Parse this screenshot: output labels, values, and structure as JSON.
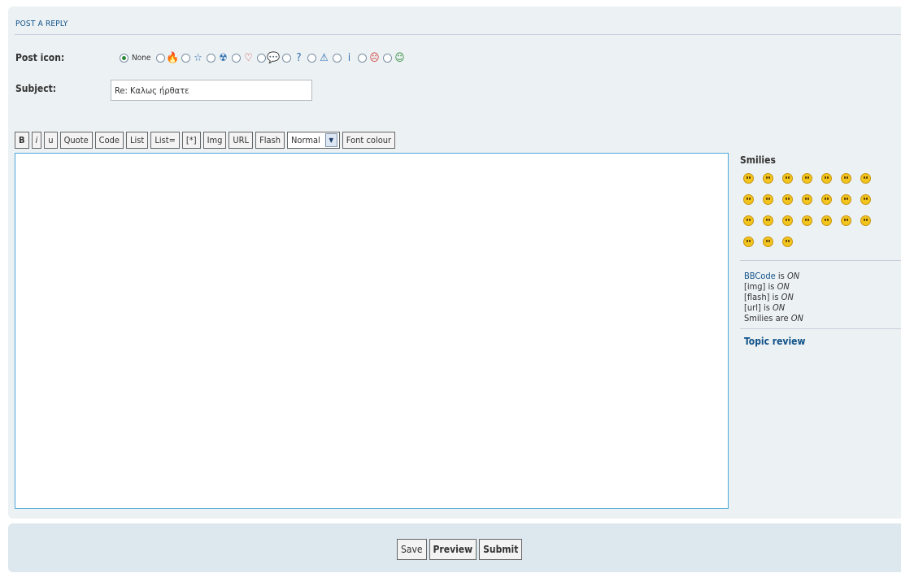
{
  "panel": {
    "title": "POST A REPLY"
  },
  "post_icon": {
    "label": "Post icon:",
    "none_label": "None",
    "options": [
      {
        "name": "flame-icon",
        "glyph": "🔥",
        "color": "#e05a1a"
      },
      {
        "name": "star-icon",
        "glyph": "☆",
        "color": "#2e6db0"
      },
      {
        "name": "radioactive-icon",
        "glyph": "☢",
        "color": "#2e6db0"
      },
      {
        "name": "heart-icon",
        "glyph": "♡",
        "color": "#d33a3a"
      },
      {
        "name": "speech-bubble-icon",
        "glyph": "💬",
        "color": "#2e6db0"
      },
      {
        "name": "question-icon",
        "glyph": "?",
        "color": "#2e6db0"
      },
      {
        "name": "warning-icon",
        "glyph": "⚠",
        "color": "#2e6db0"
      },
      {
        "name": "info-icon",
        "glyph": "i",
        "color": "#2e6db0"
      },
      {
        "name": "sad-face-icon",
        "glyph": "☹",
        "color": "#d33a3a"
      },
      {
        "name": "grin-face-icon",
        "glyph": "☺",
        "color": "#2c8a3c"
      }
    ]
  },
  "subject": {
    "label": "Subject:",
    "value": "Re: Καλως ήρθατε"
  },
  "toolbar": {
    "buttons": [
      {
        "name": "bold-button",
        "label": "B",
        "style": "b"
      },
      {
        "name": "italic-button",
        "label": "i",
        "style": "i"
      },
      {
        "name": "underline-button",
        "label": "u",
        "style": "u"
      },
      {
        "name": "quote-button",
        "label": "Quote",
        "style": ""
      },
      {
        "name": "code-button",
        "label": "Code",
        "style": ""
      },
      {
        "name": "list-button",
        "label": "List",
        "style": ""
      },
      {
        "name": "ordered-list-button",
        "label": "List=",
        "style": ""
      },
      {
        "name": "list-item-button",
        "label": "[*]",
        "style": ""
      },
      {
        "name": "img-button",
        "label": "Img",
        "style": ""
      },
      {
        "name": "url-button",
        "label": "URL",
        "style": ""
      },
      {
        "name": "flash-button",
        "label": "Flash",
        "style": ""
      }
    ],
    "font_size_value": "Normal",
    "font_colour_label": "Font colour"
  },
  "sidebar": {
    "smilies_heading": "Smilies",
    "smilies_count": 24,
    "bbcode_link": "BBCode",
    "status_lines": [
      {
        "text": "[img] is ",
        "state": "ON"
      },
      {
        "text": "[flash] is ",
        "state": "ON"
      },
      {
        "text": "[url] is ",
        "state": "ON"
      },
      {
        "text": "Smilies are ",
        "state": "ON"
      }
    ],
    "bbcode_suffix": " is ",
    "bbcode_state": "ON",
    "topic_review": "Topic review"
  },
  "actions": {
    "save": "Save",
    "preview": "Preview",
    "submit": "Submit"
  }
}
